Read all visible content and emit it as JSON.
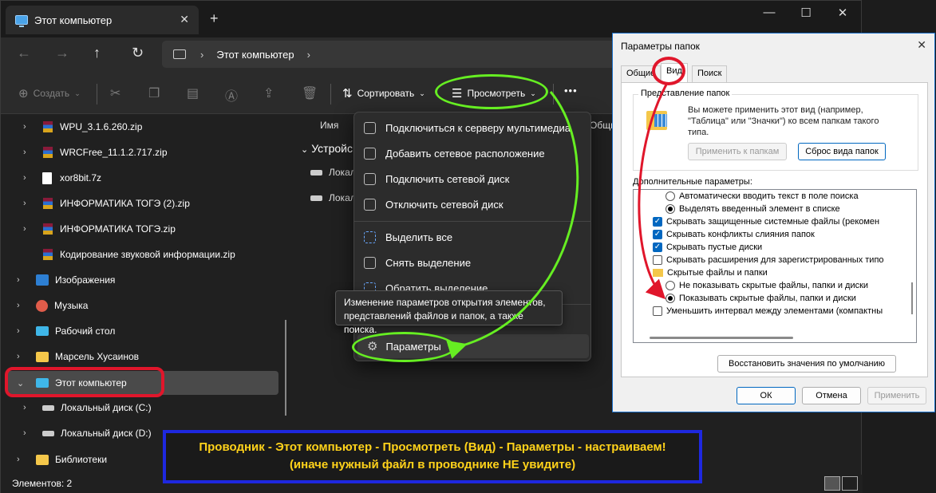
{
  "explorer": {
    "tab_title": "Этот компьютер",
    "tab_close": "✕",
    "new_tab": "+",
    "window_controls": {
      "minimize": "—",
      "maximize": "☐",
      "close": "✕"
    },
    "nav": {
      "back": "←",
      "forward": "→",
      "up": "↑",
      "refresh": "↻"
    },
    "address": {
      "crumb": "Этот компьютер",
      "separator": "›"
    },
    "toolbar": {
      "create_label": "Создать",
      "sort_label": "Сортировать",
      "view_label": "Просмотреть",
      "more_label": "•••"
    },
    "sidebar": [
      {
        "label": "WPU_3.1.6.260.zip",
        "icon": "zip-icon"
      },
      {
        "label": "WRCFree_11.1.2.717.zip",
        "icon": "zip-icon"
      },
      {
        "label": "xor8bit.7z",
        "icon": "file-icon"
      },
      {
        "label": "ИНФОРМАТИКА ТОГЭ (2).zip",
        "icon": "zip-icon"
      },
      {
        "label": "ИНФОРМАТИКА ТОГЭ.zip",
        "icon": "zip-icon"
      },
      {
        "label": "Кодирование звуковой информации.zip",
        "icon": "zip-icon"
      },
      {
        "label": "Изображения",
        "icon": "pictures-icon"
      },
      {
        "label": "Музыка",
        "icon": "music-icon"
      },
      {
        "label": "Рабочий стол",
        "icon": "desktop-icon"
      },
      {
        "label": "Марсель Хусаинов",
        "icon": "folder-icon"
      },
      {
        "label": "Этот компьютер",
        "icon": "computer-icon"
      },
      {
        "label": "Локальный диск (C:)",
        "icon": "drive-icon"
      },
      {
        "label": "Локальный диск (D:)",
        "icon": "drive-icon"
      },
      {
        "label": "Библиотеки",
        "icon": "folder-icon"
      }
    ],
    "content": {
      "column_name": "Имя",
      "column_other": "Общи",
      "group_label": "Устройс",
      "items": [
        "Локал",
        "Локал"
      ]
    },
    "status": {
      "items_count": "Элементов: 2"
    }
  },
  "menu": {
    "items": [
      {
        "label": "Подключиться к серверу мультимедиа",
        "icon": "media-server-icon"
      },
      {
        "label": "Добавить сетевое расположение",
        "icon": "network-location-icon"
      },
      {
        "label": "Подключить сетевой диск",
        "icon": "map-drive-icon"
      },
      {
        "label": "Отключить сетевой диск",
        "icon": "disconnect-drive-icon"
      },
      {
        "label": "Выделить все",
        "icon": "select-all-icon"
      },
      {
        "label": "Снять выделение",
        "icon": "select-none-icon"
      },
      {
        "label": "Обратить выделение",
        "icon": "invert-selection-icon"
      },
      {
        "label": "Параметры",
        "icon": "gear-icon"
      }
    ],
    "tooltip": "Изменение параметров открытия элементов, представлений файлов и папок, а также поиска."
  },
  "dialog": {
    "title": "Параметры папок",
    "tabs": [
      "Общие",
      "Вид",
      "Поиск"
    ],
    "folder_views": {
      "legend": "Представление папок",
      "description": "Вы можете применить этот вид (например, \"Таблица\" или \"Значки\") ко всем папкам такого типа.",
      "apply_button": "Применить к папкам",
      "reset_button": "Сброс вида папок"
    },
    "advanced_label": "Дополнительные параметры:",
    "options": [
      {
        "label": "Автоматически вводить текст в поле поиска",
        "type": "radio",
        "checked": false
      },
      {
        "label": "Выделять введенный элемент в списке",
        "type": "radio",
        "checked": true
      },
      {
        "label": "Скрывать защищенные системные файлы (рекомен",
        "type": "checkbox",
        "checked": true
      },
      {
        "label": "Скрывать конфликты слияния папок",
        "type": "checkbox",
        "checked": true
      },
      {
        "label": "Скрывать пустые диски",
        "type": "checkbox",
        "checked": true
      },
      {
        "label": "Скрывать расширения для зарегистрированных типо",
        "type": "checkbox",
        "checked": false
      },
      {
        "label": "Скрытые файлы и папки",
        "type": "folder",
        "checked": false
      },
      {
        "label": "Не показывать скрытые файлы, папки и диски",
        "type": "radio",
        "checked": false
      },
      {
        "label": "Показывать скрытые файлы, папки и диски",
        "type": "radio",
        "checked": true
      },
      {
        "label": "Уменьшить интервал между элементами (компактны",
        "type": "checkbox",
        "checked": false
      }
    ],
    "restore_button": "Восстановить значения по умолчанию",
    "ok_button": "ОК",
    "cancel_button": "Отмена",
    "apply_button": "Применить"
  },
  "banner": {
    "line1": "Проводник - Этот компьютер - Просмотреть (Вид) -  Параметры - настраиваем!",
    "line2": "(иначе нужный файл в проводнике НЕ увидите)"
  },
  "colors": {
    "highlight_red": "#e0162b",
    "highlight_green": "#66ee22",
    "banner_border": "#1e28e0",
    "banner_text": "#ffd21a"
  }
}
